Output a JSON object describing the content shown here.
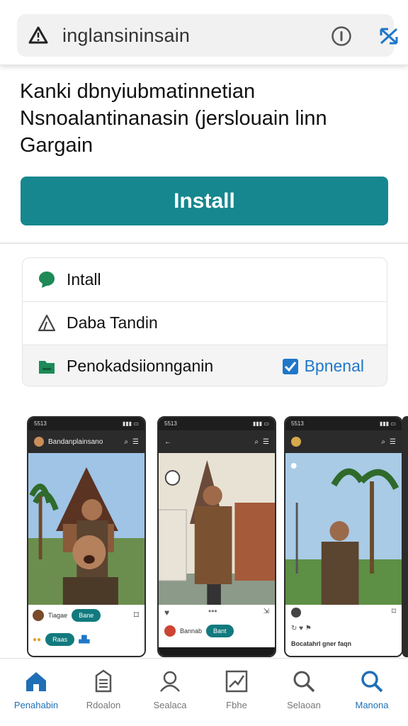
{
  "browser": {
    "url": "inglansininsain",
    "icons": [
      "warning-triangle-icon",
      "info-icon",
      "extension-icon"
    ]
  },
  "headline": {
    "line1": "Kanki dbnyiubmatinnetian",
    "line2": "Nsnoalantinanasin (jerslouain linn",
    "line3": "Gargain"
  },
  "install_label": "Install",
  "colors": {
    "accent": "#16878f",
    "link": "#1f77c9",
    "nav_active": "#1f6fb6"
  },
  "options": [
    {
      "label": "Intall",
      "icon": "chat-bubble-icon"
    },
    {
      "label": "Daba Tandin",
      "icon": "warning-outline-icon"
    },
    {
      "label": "Penokadsiionnganin",
      "icon": "folder-icon",
      "action": "Bpnenal"
    }
  ],
  "screenshots": [
    {
      "title": "Bandanplainsano",
      "time": "5513",
      "pill1": "Bane",
      "pill2": "Raas",
      "caption": "Tiagae"
    },
    {
      "title": "",
      "time": "5513",
      "pill1": "Bant",
      "caption": "Bannab"
    },
    {
      "title": "",
      "time": "5513",
      "caption": "Bocatahrl gner faqn"
    }
  ],
  "bottom_nav": [
    {
      "label": "Penahabin",
      "icon": "home-icon"
    },
    {
      "label": "Rdoalon",
      "icon": "document-icon"
    },
    {
      "label": "Sealaca",
      "icon": "profile-icon"
    },
    {
      "label": "Fbhe",
      "icon": "chart-icon"
    },
    {
      "label": "Selaoan",
      "icon": "search-icon"
    },
    {
      "label": "Manona",
      "icon": "search-icon"
    }
  ]
}
